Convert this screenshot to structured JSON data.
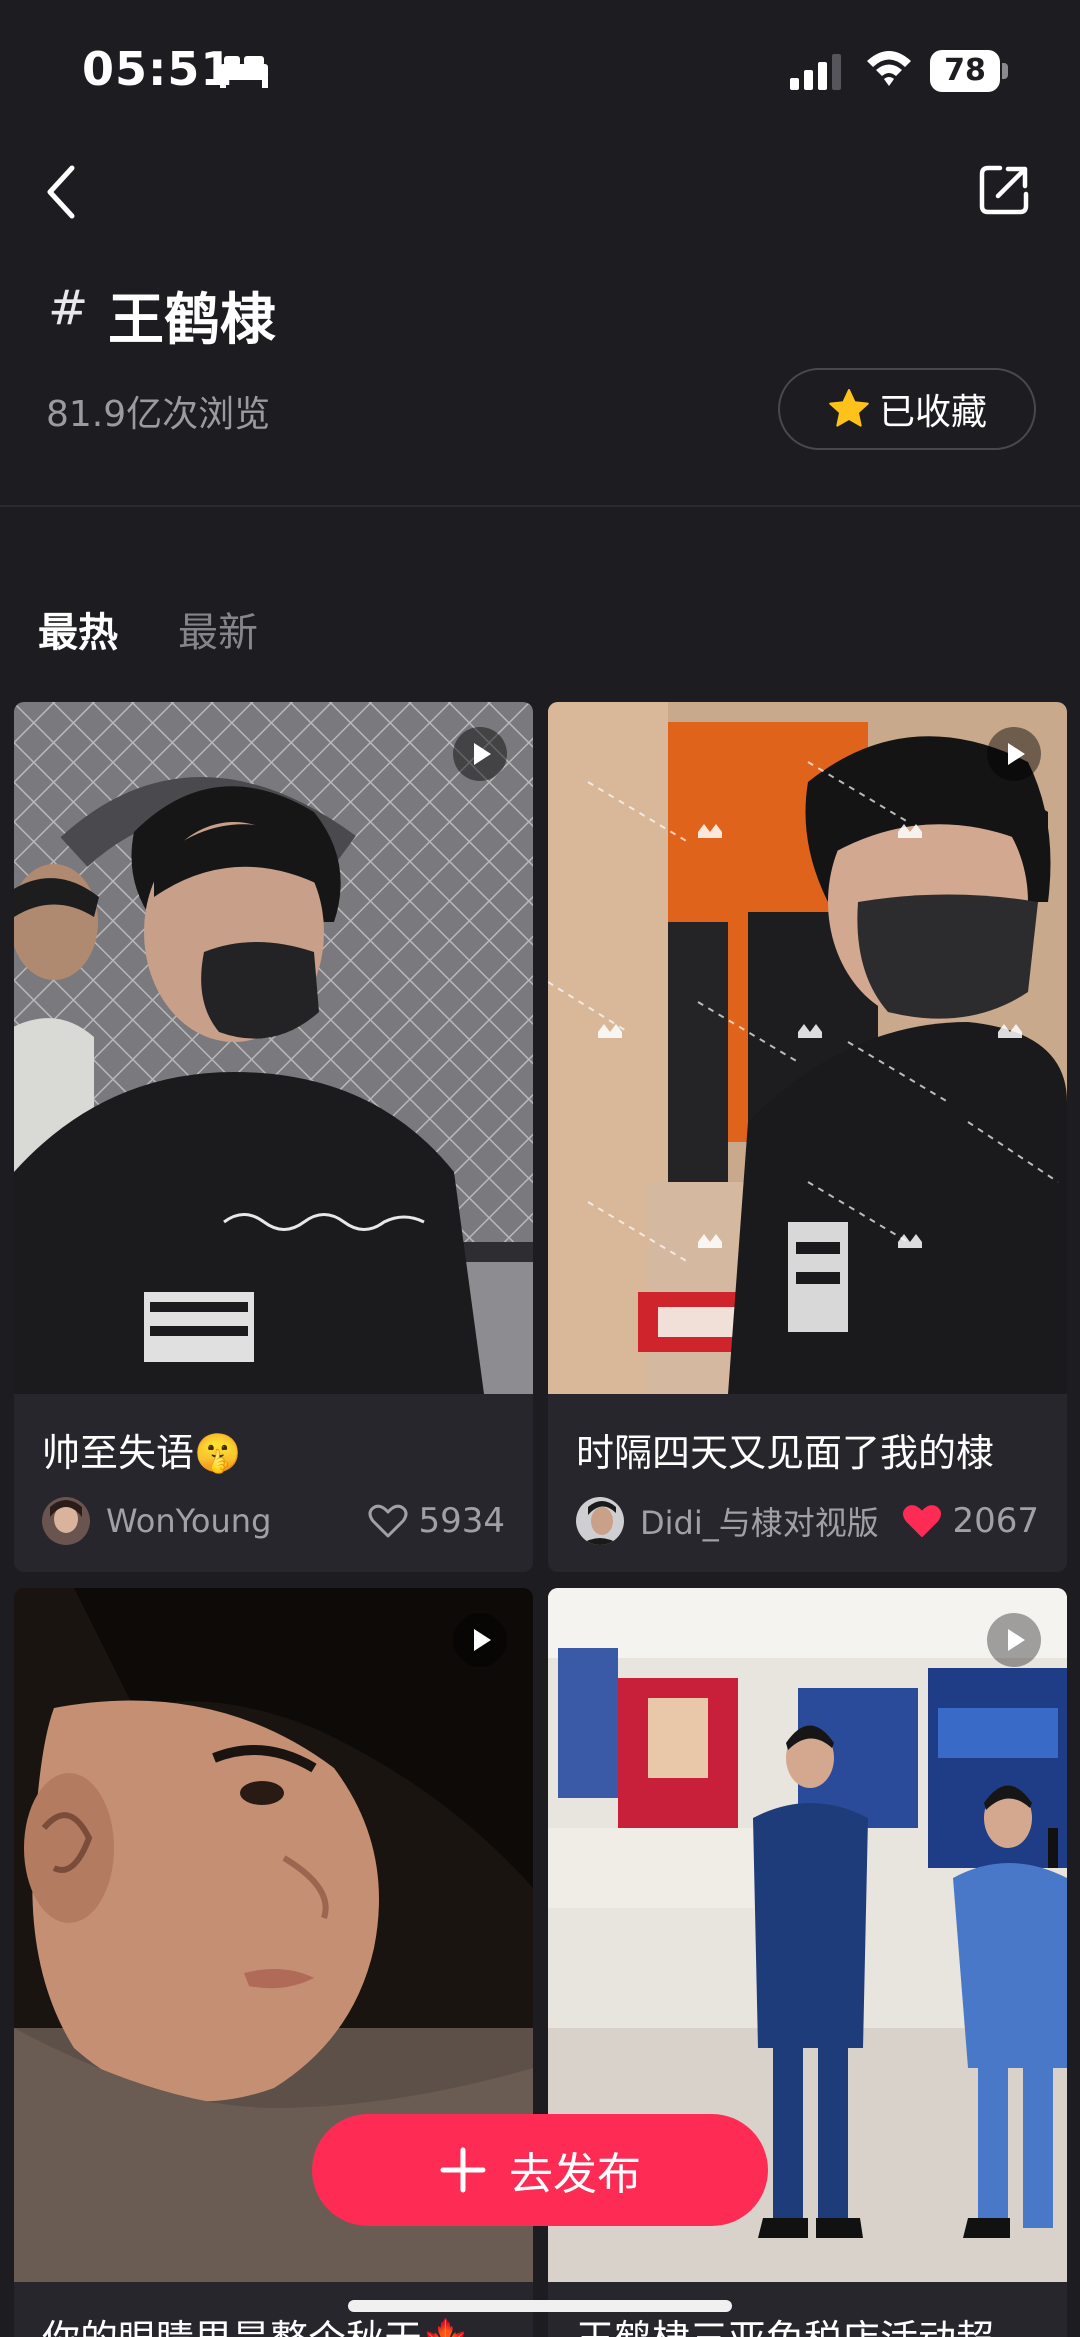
{
  "status_bar": {
    "time": "05:51",
    "battery": "78"
  },
  "topic": {
    "hash": "#",
    "title": "王鹤棣",
    "views": "81.9亿次浏览",
    "collect_label": "已收藏"
  },
  "tabs": [
    {
      "label": "最热"
    },
    {
      "label": "最新"
    }
  ],
  "cards": [
    {
      "title": "帅至失语🤫",
      "author": "WonYoung",
      "likes": "5934",
      "liked": false
    },
    {
      "title": "时隔四天又见面了我的棣",
      "author": "Didi_与棣对视版",
      "likes": "2067",
      "liked": true
    },
    {
      "title": "你的眼睛里是整个秋天🍁"
    },
    {
      "title": "王鹤棣三亚免税店活动超"
    }
  ],
  "publish": {
    "label": "去发布"
  },
  "colors": {
    "accent": "#fe2c55",
    "background": "#1c1c21",
    "card": "#26262c",
    "star": "#ffc21a"
  }
}
